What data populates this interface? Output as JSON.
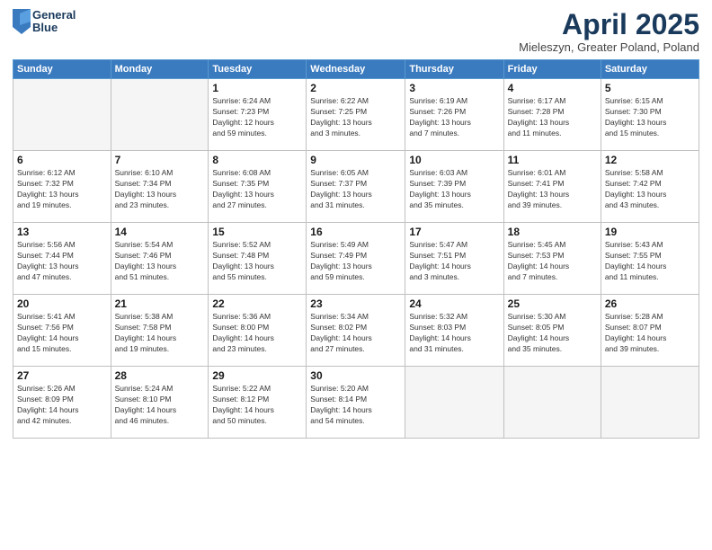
{
  "header": {
    "logo_line1": "General",
    "logo_line2": "Blue",
    "main_title": "April 2025",
    "subtitle": "Mieleszyn, Greater Poland, Poland"
  },
  "calendar": {
    "days_of_week": [
      "Sunday",
      "Monday",
      "Tuesday",
      "Wednesday",
      "Thursday",
      "Friday",
      "Saturday"
    ],
    "weeks": [
      [
        {
          "day": "",
          "info": ""
        },
        {
          "day": "",
          "info": ""
        },
        {
          "day": "1",
          "info": "Sunrise: 6:24 AM\nSunset: 7:23 PM\nDaylight: 12 hours\nand 59 minutes."
        },
        {
          "day": "2",
          "info": "Sunrise: 6:22 AM\nSunset: 7:25 PM\nDaylight: 13 hours\nand 3 minutes."
        },
        {
          "day": "3",
          "info": "Sunrise: 6:19 AM\nSunset: 7:26 PM\nDaylight: 13 hours\nand 7 minutes."
        },
        {
          "day": "4",
          "info": "Sunrise: 6:17 AM\nSunset: 7:28 PM\nDaylight: 13 hours\nand 11 minutes."
        },
        {
          "day": "5",
          "info": "Sunrise: 6:15 AM\nSunset: 7:30 PM\nDaylight: 13 hours\nand 15 minutes."
        }
      ],
      [
        {
          "day": "6",
          "info": "Sunrise: 6:12 AM\nSunset: 7:32 PM\nDaylight: 13 hours\nand 19 minutes."
        },
        {
          "day": "7",
          "info": "Sunrise: 6:10 AM\nSunset: 7:34 PM\nDaylight: 13 hours\nand 23 minutes."
        },
        {
          "day": "8",
          "info": "Sunrise: 6:08 AM\nSunset: 7:35 PM\nDaylight: 13 hours\nand 27 minutes."
        },
        {
          "day": "9",
          "info": "Sunrise: 6:05 AM\nSunset: 7:37 PM\nDaylight: 13 hours\nand 31 minutes."
        },
        {
          "day": "10",
          "info": "Sunrise: 6:03 AM\nSunset: 7:39 PM\nDaylight: 13 hours\nand 35 minutes."
        },
        {
          "day": "11",
          "info": "Sunrise: 6:01 AM\nSunset: 7:41 PM\nDaylight: 13 hours\nand 39 minutes."
        },
        {
          "day": "12",
          "info": "Sunrise: 5:58 AM\nSunset: 7:42 PM\nDaylight: 13 hours\nand 43 minutes."
        }
      ],
      [
        {
          "day": "13",
          "info": "Sunrise: 5:56 AM\nSunset: 7:44 PM\nDaylight: 13 hours\nand 47 minutes."
        },
        {
          "day": "14",
          "info": "Sunrise: 5:54 AM\nSunset: 7:46 PM\nDaylight: 13 hours\nand 51 minutes."
        },
        {
          "day": "15",
          "info": "Sunrise: 5:52 AM\nSunset: 7:48 PM\nDaylight: 13 hours\nand 55 minutes."
        },
        {
          "day": "16",
          "info": "Sunrise: 5:49 AM\nSunset: 7:49 PM\nDaylight: 13 hours\nand 59 minutes."
        },
        {
          "day": "17",
          "info": "Sunrise: 5:47 AM\nSunset: 7:51 PM\nDaylight: 14 hours\nand 3 minutes."
        },
        {
          "day": "18",
          "info": "Sunrise: 5:45 AM\nSunset: 7:53 PM\nDaylight: 14 hours\nand 7 minutes."
        },
        {
          "day": "19",
          "info": "Sunrise: 5:43 AM\nSunset: 7:55 PM\nDaylight: 14 hours\nand 11 minutes."
        }
      ],
      [
        {
          "day": "20",
          "info": "Sunrise: 5:41 AM\nSunset: 7:56 PM\nDaylight: 14 hours\nand 15 minutes."
        },
        {
          "day": "21",
          "info": "Sunrise: 5:38 AM\nSunset: 7:58 PM\nDaylight: 14 hours\nand 19 minutes."
        },
        {
          "day": "22",
          "info": "Sunrise: 5:36 AM\nSunset: 8:00 PM\nDaylight: 14 hours\nand 23 minutes."
        },
        {
          "day": "23",
          "info": "Sunrise: 5:34 AM\nSunset: 8:02 PM\nDaylight: 14 hours\nand 27 minutes."
        },
        {
          "day": "24",
          "info": "Sunrise: 5:32 AM\nSunset: 8:03 PM\nDaylight: 14 hours\nand 31 minutes."
        },
        {
          "day": "25",
          "info": "Sunrise: 5:30 AM\nSunset: 8:05 PM\nDaylight: 14 hours\nand 35 minutes."
        },
        {
          "day": "26",
          "info": "Sunrise: 5:28 AM\nSunset: 8:07 PM\nDaylight: 14 hours\nand 39 minutes."
        }
      ],
      [
        {
          "day": "27",
          "info": "Sunrise: 5:26 AM\nSunset: 8:09 PM\nDaylight: 14 hours\nand 42 minutes."
        },
        {
          "day": "28",
          "info": "Sunrise: 5:24 AM\nSunset: 8:10 PM\nDaylight: 14 hours\nand 46 minutes."
        },
        {
          "day": "29",
          "info": "Sunrise: 5:22 AM\nSunset: 8:12 PM\nDaylight: 14 hours\nand 50 minutes."
        },
        {
          "day": "30",
          "info": "Sunrise: 5:20 AM\nSunset: 8:14 PM\nDaylight: 14 hours\nand 54 minutes."
        },
        {
          "day": "",
          "info": ""
        },
        {
          "day": "",
          "info": ""
        },
        {
          "day": "",
          "info": ""
        }
      ]
    ]
  }
}
